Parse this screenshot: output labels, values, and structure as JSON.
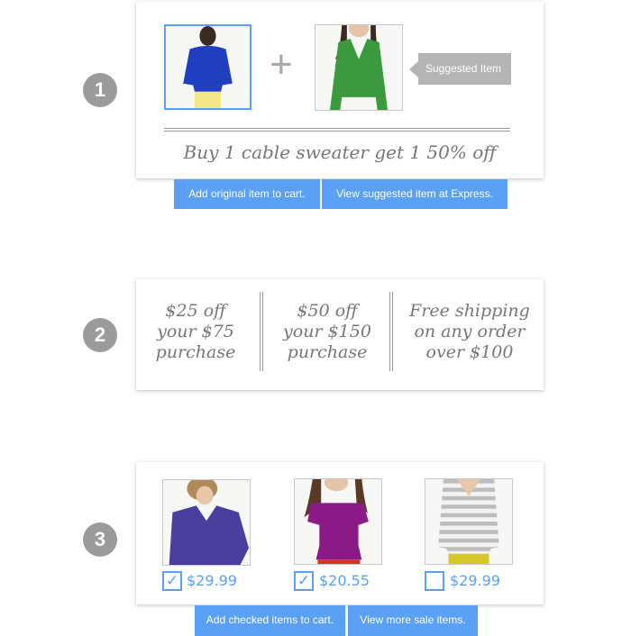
{
  "steps": [
    "1",
    "2",
    "3"
  ],
  "section1": {
    "plus": "+",
    "suggested_tag": "Suggested Item",
    "offer_text": "Buy 1 cable sweater get 1 50% off",
    "buttons": [
      "Add original item to cart.",
      "View suggested item at Express."
    ],
    "products": [
      {
        "name": "blue cable sweater",
        "color": "#1f3fbf"
      },
      {
        "name": "green v-neck sweater",
        "color": "#3b9a3e"
      }
    ]
  },
  "section2": {
    "offers": [
      [
        "$25 off",
        "your $75",
        "purchase"
      ],
      [
        "$50 off",
        "your $150",
        "purchase"
      ],
      [
        "Free shipping",
        "on any order",
        "over $100"
      ]
    ]
  },
  "section3": {
    "items": [
      {
        "price": "$29.99",
        "checked": true,
        "color": "#4a3f9e"
      },
      {
        "price": "$20.55",
        "checked": true,
        "color": "#8a1a86"
      },
      {
        "price": "$29.99",
        "checked": false,
        "color": "#bdbdbd"
      }
    ],
    "check_mark": "✓",
    "buttons": [
      "Add checked items to cart.",
      "View more sale items."
    ]
  },
  "colors": {
    "accent": "#5aa0f5",
    "step_circle": "#9b9b9b",
    "tag": "#b4b4b4"
  }
}
